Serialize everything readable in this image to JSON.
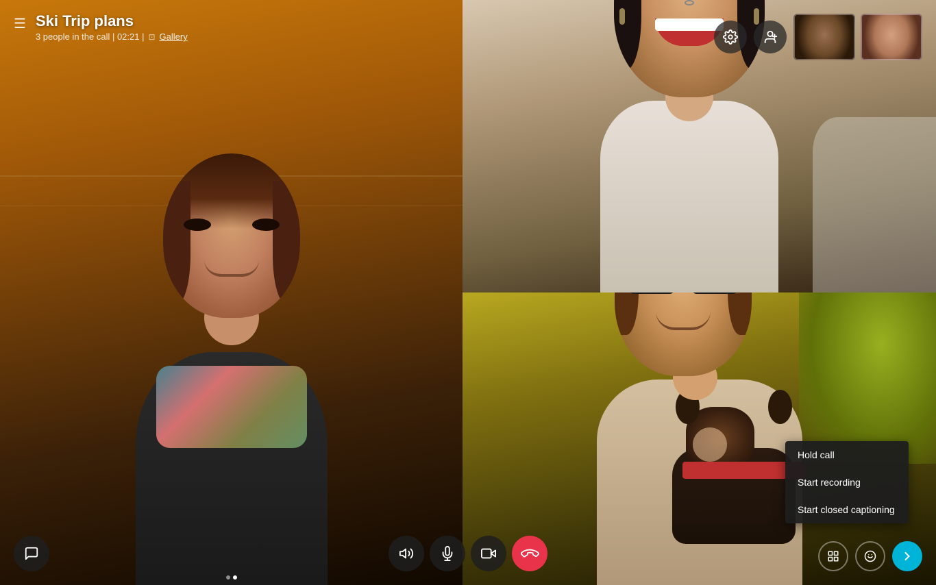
{
  "header": {
    "menu_icon": "☰",
    "title": "Ski Trip plans",
    "meta": "3 people in the call | 02:21  |",
    "gallery_label": "Gallery"
  },
  "participants": {
    "count": 3
  },
  "controls": {
    "settings_label": "Settings",
    "add_person_label": "Add person",
    "volume_label": "Volume",
    "mute_label": "Mute",
    "video_label": "Video",
    "end_call_label": "End call",
    "more_label": "More options",
    "layout_label": "Layout",
    "reactions_label": "Reactions",
    "chat_label": "Chat"
  },
  "context_menu": {
    "items": [
      {
        "label": "Hold call"
      },
      {
        "label": "Start recording"
      },
      {
        "label": "Start closed captioning"
      }
    ]
  },
  "dots": [
    {
      "active": false
    },
    {
      "active": true
    }
  ]
}
